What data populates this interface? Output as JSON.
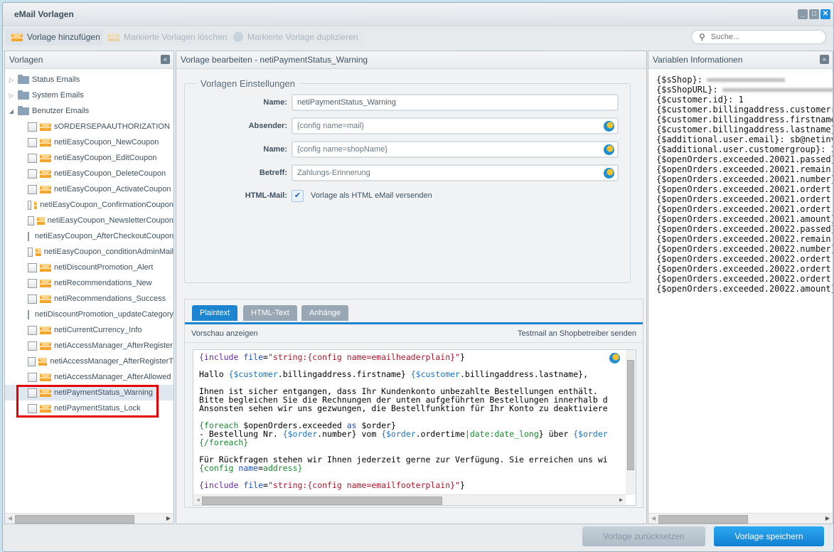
{
  "window": {
    "title": "eMail Vorlagen",
    "controls": [
      "minimize",
      "maximize",
      "close"
    ]
  },
  "toolbar": {
    "add_label": "Vorlage hinzufügen",
    "delete_label": "Markierte Vorlagen löschen",
    "duplicate_label": "Markierte Vorlage duplizieren",
    "search_placeholder": "Suche..."
  },
  "left_panel": {
    "title": "Vorlagen",
    "folders": [
      {
        "label": "Status Emails",
        "expanded": false
      },
      {
        "label": "System Emails",
        "expanded": false
      },
      {
        "label": "Benutzer Emails",
        "expanded": true
      }
    ],
    "templates": [
      "sORDERSEPAAUTHORIZATION",
      "netiEasyCoupon_NewCoupon",
      "netiEasyCoupon_EditCoupon",
      "netiEasyCoupon_DeleteCoupon",
      "netiEasyCoupon_ActivateCoupon",
      "netiEasyCoupon_ConfirmationCoupon",
      "netiEasyCoupon_NewsletterCoupon",
      "netiEasyCoupon_AfterCheckoutCoupon",
      "netiEasyCoupon_conditionAdminMail",
      "netiDiscountPromotion_Alert",
      "netiRecommendations_New",
      "netiRecommendations_Success",
      "netiDiscountPromotion_updateCategory",
      "netiCurrentCurrency_Info",
      "netiAccessManager_AfterRegister",
      "netiAccessManager_AfterRegisterT",
      "netiAccessManager_AfterAllowed",
      "netiPaymentStatus_Warning",
      "netiPaymentStatus_Lock"
    ],
    "selected": "netiPaymentStatus_Warning"
  },
  "center_panel": {
    "title": "Vorlage bearbeiten - netiPaymentStatus_Warning",
    "settings_legend": "Vorlagen Einstellungen",
    "fields": {
      "name_label": "Name:",
      "name_value": "netiPaymentStatus_Warning",
      "sender_label": "Absender:",
      "sender_value": "{config name=mail}",
      "sender_name_label": "Name:",
      "sender_name_value": "{config name=shopName}",
      "subject_label": "Betreff:",
      "subject_value": "Zahlungs-Erinnerung",
      "html_label": "HTML-Mail:",
      "html_checked": true,
      "html_checkbox_label": "Vorlage als HTML eMail versenden"
    },
    "tabs": [
      "Plaintext",
      "HTML-Text",
      "Anhänge"
    ],
    "active_tab": "Plaintext",
    "preview_link": "Vorschau anzeigen",
    "testmail_link": "Testmail an Shopbetreiber senden",
    "code_lines": [
      "{include file=\"string:{config name=emailheaderplain}\"}",
      "",
      "Hallo {$customer.billingaddress.firstname} {$customer.billingaddress.lastname},",
      "",
      "Ihnen ist sicher entgangen, dass Ihr Kundenkonto unbezahlte Bestellungen enthält.",
      "Bitte begleichen Sie die Rechnungen der unten aufgeführten Bestellungen innerhalb d",
      "Ansonsten sehen wir uns gezwungen, die Bestellfunktion für Ihr Konto zu deaktiviere",
      "",
      "{foreach $openOrders.exceeded as $order}",
      "- Bestellung Nr. {$order.number} vom {$order.ordertime|date:date_long} über {$order",
      "{/foreach}",
      "",
      "Für Rückfragen stehen wir Ihnen jederzeit gerne zur Verfügung. Sie erreichen uns wi",
      "{config name=address}",
      "",
      "{include file=\"string:{config name=emailfooterplain}\"}"
    ]
  },
  "right_panel": {
    "title": "Variablen Informationen",
    "variables": [
      {
        "key": "{$sShop}:",
        "value": "",
        "redacted": true
      },
      {
        "key": "{$sShopURL}:",
        "value": "",
        "redacted": true
      },
      {
        "key": "{$customer.id}:",
        "value": "1"
      },
      {
        "key": "{$customer.billingaddress.customerr",
        "value": ""
      },
      {
        "key": "{$customer.billingaddress.firstname",
        "value": ""
      },
      {
        "key": "{$customer.billingaddress.lastname}",
        "value": ""
      },
      {
        "key": "{$additional.user.email}:",
        "value": "sb@netinv"
      },
      {
        "key": "{$additional.user.customergroup}:",
        "value": "I"
      },
      {
        "key": "{$openOrders.exceeded.20021.passed}",
        "value": ""
      },
      {
        "key": "{$openOrders.exceeded.20021.remain:",
        "value": ""
      },
      {
        "key": "{$openOrders.exceeded.20021.number}",
        "value": ""
      },
      {
        "key": "{$openOrders.exceeded.20021.ordert:",
        "value": ""
      },
      {
        "key": "{$openOrders.exceeded.20021.ordert:",
        "value": ""
      },
      {
        "key": "{$openOrders.exceeded.20021.ordert:",
        "value": ""
      },
      {
        "key": "{$openOrders.exceeded.20021.amount}",
        "value": ""
      },
      {
        "key": "{$openOrders.exceeded.20022.passed}",
        "value": ""
      },
      {
        "key": "{$openOrders.exceeded.20022.remain:",
        "value": ""
      },
      {
        "key": "{$openOrders.exceeded.20022.number}",
        "value": ""
      },
      {
        "key": "{$openOrders.exceeded.20022.ordert:",
        "value": ""
      },
      {
        "key": "{$openOrders.exceeded.20022.ordert:",
        "value": ""
      },
      {
        "key": "{$openOrders.exceeded.20022.ordert:",
        "value": ""
      },
      {
        "key": "{$openOrders.exceeded.20022.amount}",
        "value": ""
      }
    ]
  },
  "footer": {
    "reset_label": "Vorlage zurücksetzen",
    "save_label": "Vorlage speichern"
  },
  "colors": {
    "accent": "#1d84cf",
    "highlight_box": "#e30000",
    "mail_icon": "#f3a529"
  }
}
